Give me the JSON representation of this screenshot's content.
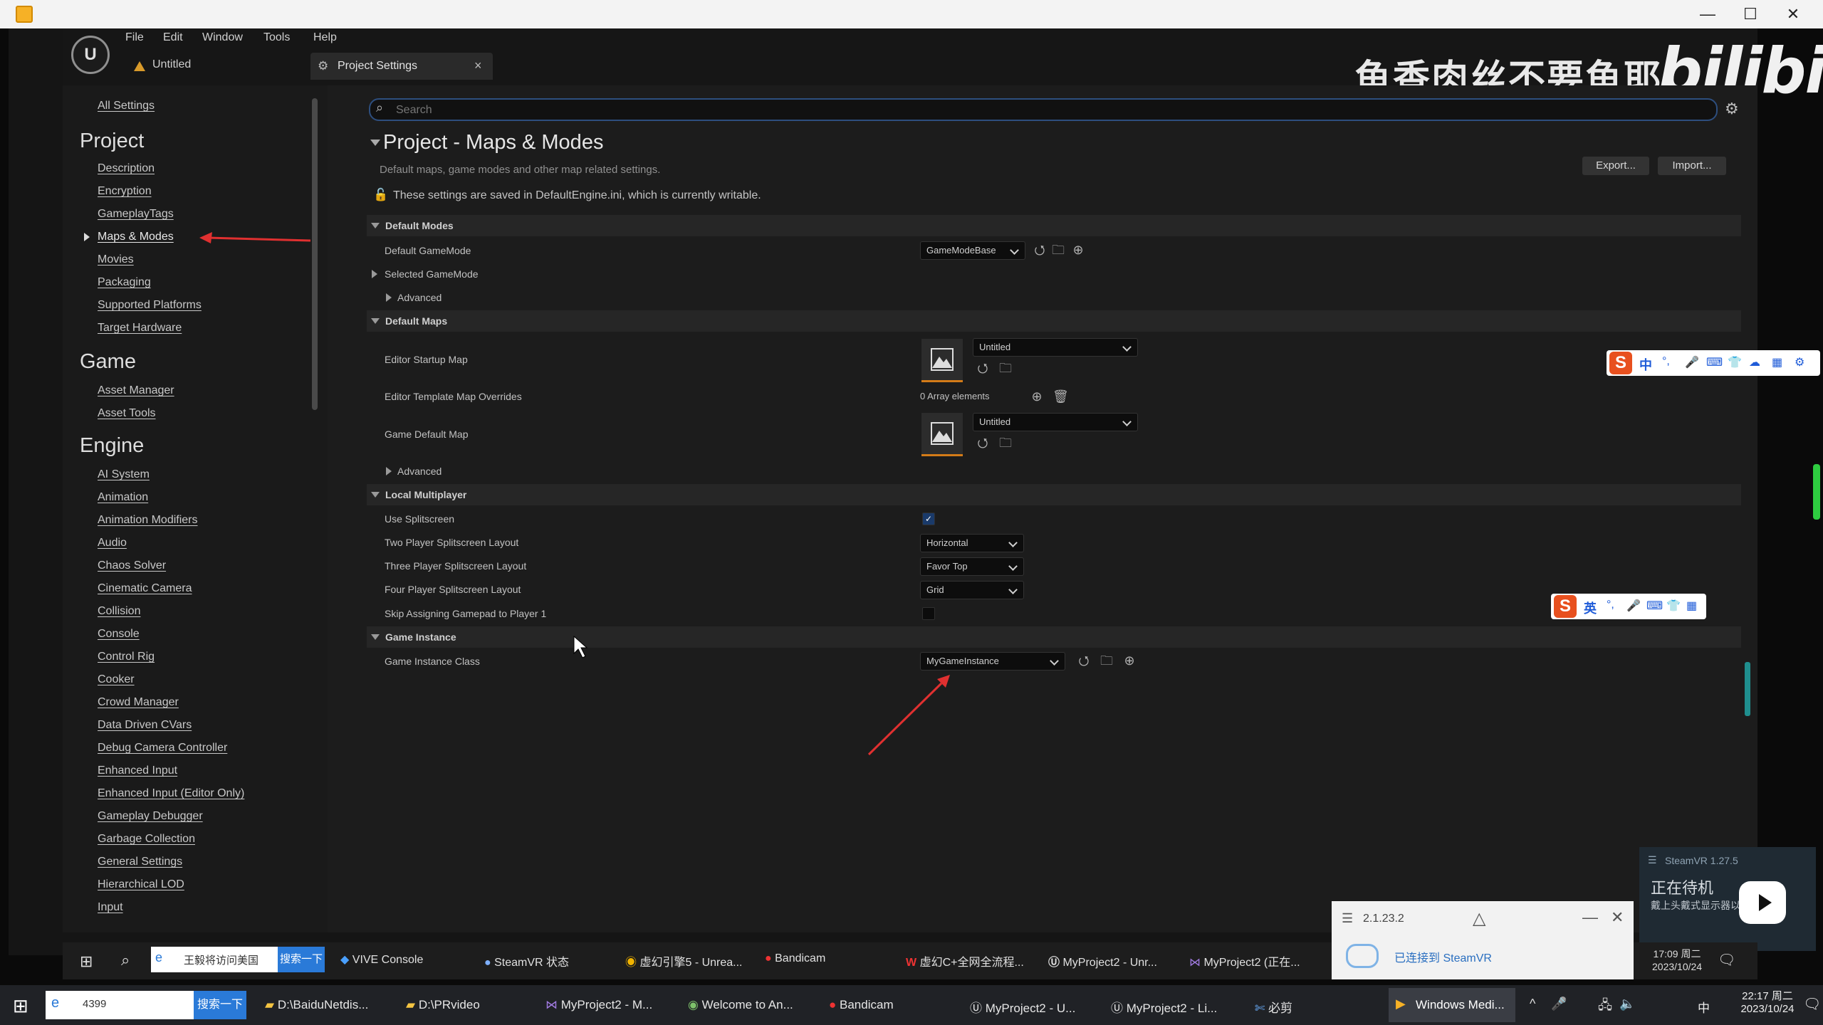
{
  "player": {
    "buttons": {
      "minimize": "—",
      "maximize": "☐",
      "close": "✕"
    }
  },
  "watermark": {
    "text": "鱼香肉丝不要鱼耶",
    "logo": "bilibili"
  },
  "ue": {
    "logo": "U",
    "menu": [
      "File",
      "Edit",
      "Window",
      "Tools",
      "Help"
    ],
    "level_tab": "Untitled",
    "settings_tab": "Project Settings",
    "tab_close": "×"
  },
  "sidebar": {
    "all_settings": "All Settings",
    "groups": [
      {
        "heading": "Project",
        "items": [
          "Description",
          "Encryption",
          "GameplayTags",
          "Maps & Modes",
          "Movies",
          "Packaging",
          "Supported Platforms",
          "Target Hardware"
        ]
      },
      {
        "heading": "Game",
        "items": [
          "Asset Manager",
          "Asset Tools"
        ]
      },
      {
        "heading": "Engine",
        "items": [
          "AI System",
          "Animation",
          "Animation Modifiers",
          "Audio",
          "Chaos Solver",
          "Cinematic Camera",
          "Collision",
          "Console",
          "Control Rig",
          "Cooker",
          "Crowd Manager",
          "Data Driven CVars",
          "Debug Camera Controller",
          "Enhanced Input",
          "Enhanced Input (Editor Only)",
          "Gameplay Debugger",
          "Garbage Collection",
          "General Settings",
          "Hierarchical LOD",
          "Input"
        ]
      }
    ],
    "selected": "Maps & Modes"
  },
  "main": {
    "search_placeholder": "Search",
    "title": "Project - Maps & Modes",
    "subtitle": "Default maps, game modes and other map related settings.",
    "writable_notice": "These settings are saved in DefaultEngine.ini, which is currently writable.",
    "export_label": "Export...",
    "import_label": "Import...",
    "sections": {
      "default_modes": "Default Modes",
      "default_maps": "Default Maps",
      "local_multiplayer": "Local Multiplayer",
      "game_instance": "Game Instance"
    },
    "props": {
      "default_gamemode": "Default GameMode",
      "default_gamemode_value": "GameModeBase",
      "selected_gamemode": "Selected GameMode",
      "advanced": "Advanced",
      "editor_startup_map": "Editor Startup Map",
      "editor_startup_map_value": "Untitled",
      "editor_template_overrides": "Editor Template Map Overrides",
      "array_elements": "0 Array elements",
      "game_default_map": "Game Default Map",
      "game_default_map_value": "Untitled",
      "use_splitscreen": "Use Splitscreen",
      "two_player": "Two Player Splitscreen Layout",
      "two_player_value": "Horizontal",
      "three_player": "Three Player Splitscreen Layout",
      "three_player_value": "Favor Top",
      "four_player": "Four Player Splitscreen Layout",
      "four_player_value": "Grid",
      "skip_gamepad": "Skip Assigning Gamepad to Player 1",
      "game_instance_class": "Game Instance Class",
      "game_instance_class_value": "MyGameInstance"
    }
  },
  "ime": {
    "bar1": [
      "中",
      "°,",
      "🎤",
      "⌨",
      "👕",
      "☁",
      "▦",
      "⚙"
    ],
    "bar2": [
      "英",
      "°,",
      "🎤",
      "⌨",
      "👕",
      "▦"
    ],
    "logo": "S"
  },
  "steamvr": {
    "version": "SteamVR 1.27.5",
    "status": "正在待机",
    "detail": "戴上头戴式显示器以",
    "toast_version": "2.1.23.2",
    "toast_message": "已连接到 SteamVR"
  },
  "inner_taskbar": {
    "search_text": "王毅将访问美国",
    "search_button": "搜索一下",
    "items": [
      "VIVE Console",
      "SteamVR 状态",
      "虚幻引擎5 - Unrea...",
      "Bandicam",
      "虚幻C+全网全流程...",
      "MyProject2 - Unr...",
      "MyProject2 (正在..."
    ],
    "time": "17:09 周二",
    "date": "2023/10/24"
  },
  "outer_taskbar": {
    "search_text": "4399",
    "search_button": "搜索一下",
    "items": [
      "D:\\BaiduNetdis...",
      "D:\\PRvideo",
      "MyProject2 - M...",
      "Welcome to An...",
      "Bandicam",
      "MyProject2 - U...",
      "MyProject2 - Li...",
      "必剪",
      "Windows Medi..."
    ],
    "tray_lang": "中",
    "time": "22:17 周二",
    "date": "2023/10/24"
  }
}
